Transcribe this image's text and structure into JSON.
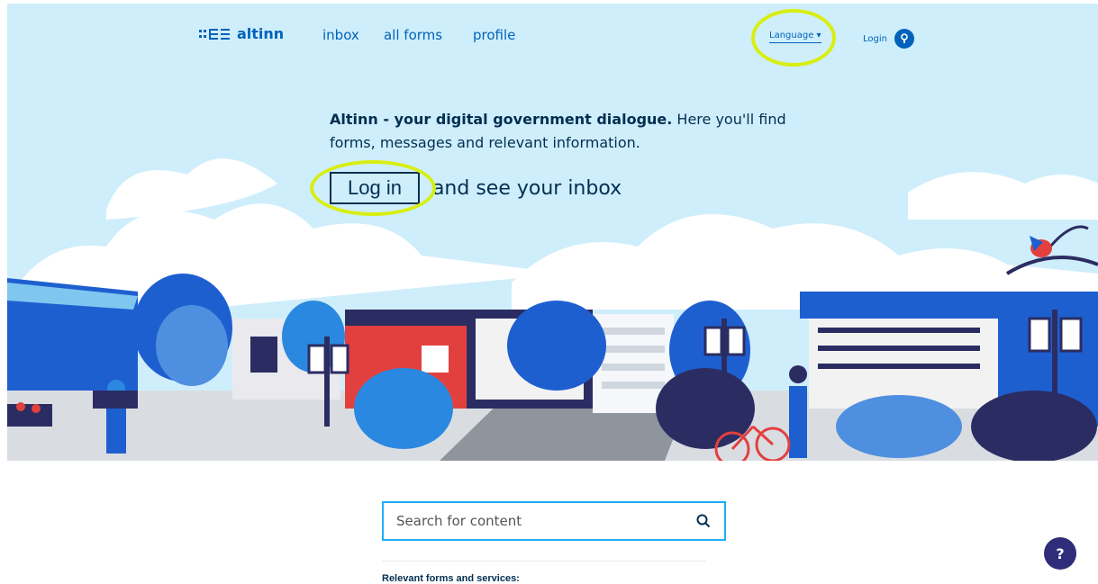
{
  "nav": {
    "logo_text": "altinn",
    "links": [
      "inbox",
      "all forms",
      "profile"
    ],
    "language_label": "Language ▾",
    "login_label": "Login"
  },
  "hero": {
    "intro_bold": "Altinn - your digital government dialogue.",
    "intro_rest": " Here you'll find forms, messages and relevant information.",
    "login_button": "Log in",
    "cta_text": "and see your inbox"
  },
  "search": {
    "placeholder": "Search for content"
  },
  "relevant_heading": "Relevant forms and services:",
  "help_label": "?",
  "colors": {
    "brand_blue": "#0062ba",
    "dark_navy": "#022f51",
    "sky": "#cfeefb",
    "highlight": "#d8ee12"
  }
}
